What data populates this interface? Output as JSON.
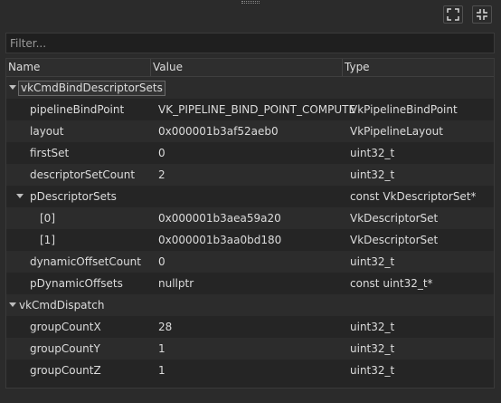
{
  "toolbar": {
    "maximize_icon": "fullscreen-expand-icon",
    "restore_icon": "fullscreen-collapse-icon"
  },
  "filter": {
    "placeholder": "Filter...",
    "value": ""
  },
  "columns": {
    "name": "Name",
    "value": "Value",
    "type": "Type"
  },
  "rows": [
    {
      "name": "vkCmdBindDescriptorSets",
      "value": "",
      "type": "",
      "depth": 0,
      "expandable": true,
      "selected": true
    },
    {
      "name": "pipelineBindPoint",
      "value": "VK_PIPELINE_BIND_POINT_COMPUTE",
      "type": "VkPipelineBindPoint",
      "depth": 1,
      "expandable": false
    },
    {
      "name": "layout",
      "value": "0x000001b3af52aeb0",
      "type": "VkPipelineLayout",
      "depth": 1,
      "expandable": false
    },
    {
      "name": "firstSet",
      "value": "0",
      "type": "uint32_t",
      "depth": 1,
      "expandable": false
    },
    {
      "name": "descriptorSetCount",
      "value": "2",
      "type": "uint32_t",
      "depth": 1,
      "expandable": false
    },
    {
      "name": "pDescriptorSets",
      "value": "",
      "type": "const VkDescriptorSet*",
      "depth": 1,
      "expandable": true
    },
    {
      "name": "[0]",
      "value": "0x000001b3aea59a20",
      "type": "VkDescriptorSet",
      "depth": 2,
      "expandable": false
    },
    {
      "name": "[1]",
      "value": "0x000001b3aa0bd180",
      "type": "VkDescriptorSet",
      "depth": 2,
      "expandable": false
    },
    {
      "name": "dynamicOffsetCount",
      "value": "0",
      "type": "uint32_t",
      "depth": 1,
      "expandable": false
    },
    {
      "name": "pDynamicOffsets",
      "value": "nullptr",
      "type": "const uint32_t*",
      "depth": 1,
      "expandable": false
    },
    {
      "name": "vkCmdDispatch",
      "value": "",
      "type": "",
      "depth": 0,
      "expandable": true
    },
    {
      "name": "groupCountX",
      "value": "28",
      "type": "uint32_t",
      "depth": 1,
      "expandable": false
    },
    {
      "name": "groupCountY",
      "value": "1",
      "type": "uint32_t",
      "depth": 1,
      "expandable": false
    },
    {
      "name": "groupCountZ",
      "value": "1",
      "type": "uint32_t",
      "depth": 1,
      "expandable": false
    }
  ]
}
